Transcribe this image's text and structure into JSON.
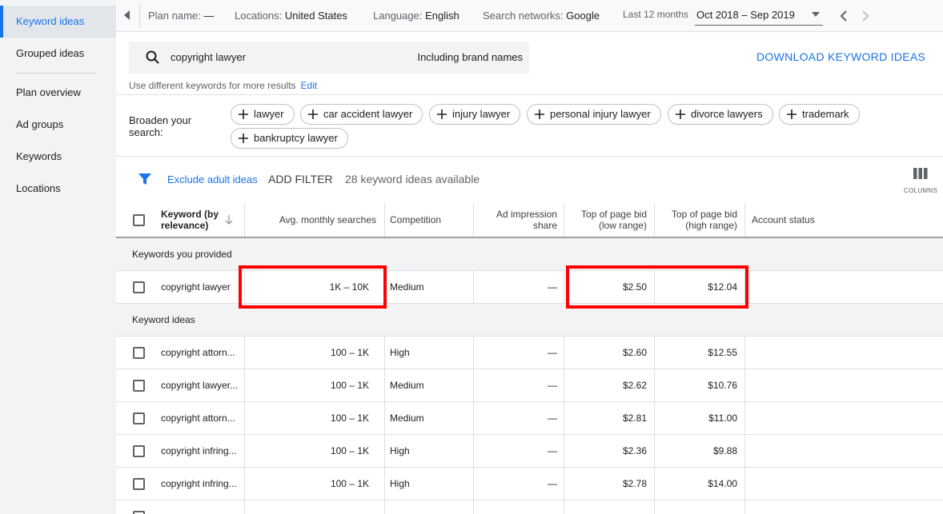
{
  "sidebar": {
    "items": [
      {
        "label": "Keyword ideas",
        "active": true
      },
      {
        "label": "Grouped ideas"
      },
      {
        "label": "Plan overview"
      },
      {
        "label": "Ad groups"
      },
      {
        "label": "Keywords"
      },
      {
        "label": "Locations"
      }
    ]
  },
  "topbar": {
    "plan_name_label": "Plan name:",
    "plan_name_value": "—",
    "locations_label": "Locations:",
    "locations_value": "United States",
    "language_label": "Language:",
    "language_value": "English",
    "networks_label": "Search networks:",
    "networks_value": "Google",
    "date_label": "Last 12 months",
    "date_value": "Oct 2018 – Sep 2019"
  },
  "search": {
    "query": "copyright lawyer",
    "brand_label": "Including brand names",
    "hint": "Use different keywords for more results",
    "edit_label": "Edit",
    "download_label": "DOWNLOAD KEYWORD IDEAS"
  },
  "broaden": {
    "label": "Broaden your search:",
    "chips": [
      "lawyer",
      "car accident lawyer",
      "injury lawyer",
      "personal injury lawyer",
      "divorce lawyers",
      "trademark",
      "bankruptcy lawyer"
    ]
  },
  "filter": {
    "exclude_label": "Exclude adult ideas",
    "add_filter_label": "ADD FILTER",
    "available_label": "28 keyword ideas available",
    "columns_label": "COLUMNS"
  },
  "table": {
    "headers": {
      "keyword": "Keyword (by relevance)",
      "avg": "Avg. monthly searches",
      "competition": "Competition",
      "impression": "Ad impression share",
      "bid_low": "Top of page bid (low range)",
      "bid_high": "Top of page bid (high range)",
      "status": "Account status"
    },
    "section_provided": "Keywords you provided",
    "section_ideas": "Keyword ideas",
    "provided": [
      {
        "keyword": "copyright lawyer",
        "avg": "1K – 10K",
        "competition": "Medium",
        "impression": "—",
        "bid_low": "$2.50",
        "bid_high": "$12.04"
      }
    ],
    "ideas": [
      {
        "keyword": "copyright attorn...",
        "avg": "100 – 1K",
        "competition": "High",
        "impression": "—",
        "bid_low": "$2.60",
        "bid_high": "$12.55"
      },
      {
        "keyword": "copyright lawyer...",
        "avg": "100 – 1K",
        "competition": "Medium",
        "impression": "—",
        "bid_low": "$2.62",
        "bid_high": "$10.76"
      },
      {
        "keyword": "copyright attorn...",
        "avg": "100 – 1K",
        "competition": "Medium",
        "impression": "—",
        "bid_low": "$2.81",
        "bid_high": "$11.00"
      },
      {
        "keyword": "copyright infring...",
        "avg": "100 – 1K",
        "competition": "High",
        "impression": "—",
        "bid_low": "$2.36",
        "bid_high": "$9.88"
      },
      {
        "keyword": "copyright infring...",
        "avg": "100 – 1K",
        "competition": "High",
        "impression": "—",
        "bid_low": "$2.78",
        "bid_high": "$14.00"
      }
    ]
  },
  "colors": {
    "accent": "#1a73e8",
    "highlight": "#ff0000"
  }
}
